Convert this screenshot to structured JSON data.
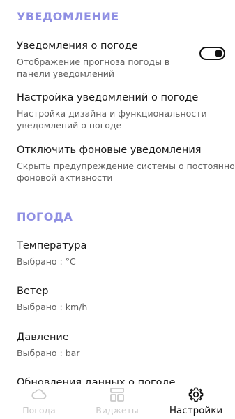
{
  "notifications_section": {
    "title": "УВЕДОМЛЕНИЕ",
    "weather_notifications": {
      "title": "Уведомления о погоде",
      "subtitle_line1": " Отображение прогноза погоды в",
      "subtitle_line2": "панели уведомлений",
      "enabled": true
    },
    "notification_settings": {
      "title": "Настройка уведомлений о погоде",
      "subtitle_line1": "Настройка дизайна и функциональности",
      "subtitle_line2": "уведомлений о погоде"
    },
    "disable_background": {
      "title": "Отключить фоновые уведомления",
      "subtitle_line1": "Скрыть предупреждение системы о постоянной",
      "subtitle_line2": "фоновой активности"
    }
  },
  "weather_section": {
    "title": "ПОГОДА",
    "temperature": {
      "title": "Температура",
      "value": "Выбрано : °C"
    },
    "wind": {
      "title": "Ветер",
      "value": "Выбрано : km/h"
    },
    "pressure": {
      "title": "Давление",
      "value": "Выбрано : bar"
    },
    "cutoff_item": "Обновления данных о погоде"
  },
  "bottom_nav": {
    "items": [
      {
        "label": "Погода",
        "icon": "cloud-icon",
        "active": false
      },
      {
        "label": "Виджеты",
        "icon": "widgets-icon",
        "active": false
      },
      {
        "label": "Настройки",
        "icon": "gear-icon",
        "active": true
      }
    ]
  },
  "colors": {
    "section_title": "#8f8fe3",
    "text_primary": "#1b1b1b",
    "text_secondary": "#5f5f5f",
    "nav_inactive": "#c9c9c9"
  }
}
